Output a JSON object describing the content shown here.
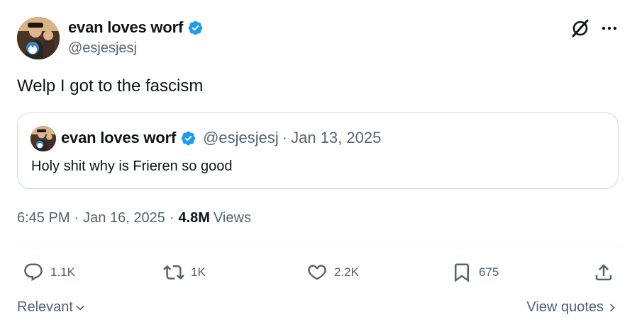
{
  "author": {
    "display_name": "evan loves worf",
    "handle": "@esjesjesj",
    "verified_color": "#1d9bf0"
  },
  "tweet": {
    "text": "Welp I got to the fascism"
  },
  "quoted_tweet": {
    "display_name": "evan loves worf",
    "handle": "@esjesjesj",
    "separator": "·",
    "date": "Jan 13, 2025",
    "text": "Holy shit why is Frieren so good"
  },
  "meta": {
    "time": "6:45 PM",
    "separator": "·",
    "date": "Jan 16, 2025",
    "separator2": "·",
    "views_count": "4.8M",
    "views_label": "Views"
  },
  "actions": {
    "replies": "1.1K",
    "reposts": "1K",
    "likes": "2.2K",
    "bookmarks": "675"
  },
  "footer": {
    "sort_label": "Relevant",
    "view_quotes_label": "View quotes"
  },
  "icons": {
    "grok": "grok-icon",
    "more": "more-icon",
    "reply": "reply-icon",
    "repost": "repost-icon",
    "like": "heart-icon",
    "bookmark": "bookmark-icon",
    "share": "share-icon"
  },
  "colors": {
    "text": "#0f1419",
    "secondary": "#536471",
    "border": "#cfd9de",
    "accent": "#1d9bf0"
  }
}
